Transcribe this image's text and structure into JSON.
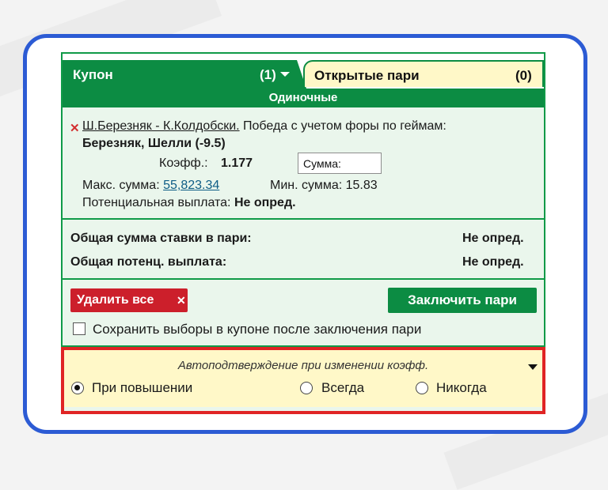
{
  "tabs": {
    "coupon": {
      "label": "Купон",
      "count": "(1)"
    },
    "open": {
      "label": "Открытые пари",
      "count": "(0)"
    }
  },
  "section_title": "Одиночные",
  "bet": {
    "match_link": "Ш.Березняк - К.Колдобски.",
    "market": "Победа с учетом форы по геймам:",
    "selection": "Березняк, Шелли (-9.5)",
    "odds_label": "Коэфф.:",
    "odds_value": "1.177",
    "amount_placeholder": "Сумма:",
    "max_label": "Макс. сумма:",
    "max_value": "55,823.34",
    "min_label": "Мин. сумма:",
    "min_value": "15.83",
    "payout_label": "Потенциальная выплата:",
    "payout_value": "Не опред."
  },
  "totals": {
    "stake_label": "Общая сумма ставки в пари:",
    "stake_value": "Не опред.",
    "payout_label": "Общая потенц. выплата:",
    "payout_value": "Не опред."
  },
  "actions": {
    "delete_all": "Удалить все",
    "place_bet": "Заключить пари",
    "keep_selections": "Сохранить выборы в купоне после заключения пари"
  },
  "auto_confirm": {
    "title": "Автоподтверждение при изменении коэфф.",
    "options": [
      "При повышении",
      "Всегда",
      "Никогда"
    ],
    "selected": "При повышении"
  },
  "colors": {
    "brand_green": "#0c8c43",
    "panel_green": "#eaf6ec",
    "delete_red": "#cc1f2b",
    "highlight_red": "#e02424",
    "frame_blue": "#2c5bd4",
    "auto_panel_yellow": "#fff8c8"
  },
  "icons": {
    "remove": "close-x-icon",
    "delete_all": "close-x-icon",
    "coupon_tab": "caret-down-icon",
    "auto_confirm": "caret-down-icon"
  }
}
